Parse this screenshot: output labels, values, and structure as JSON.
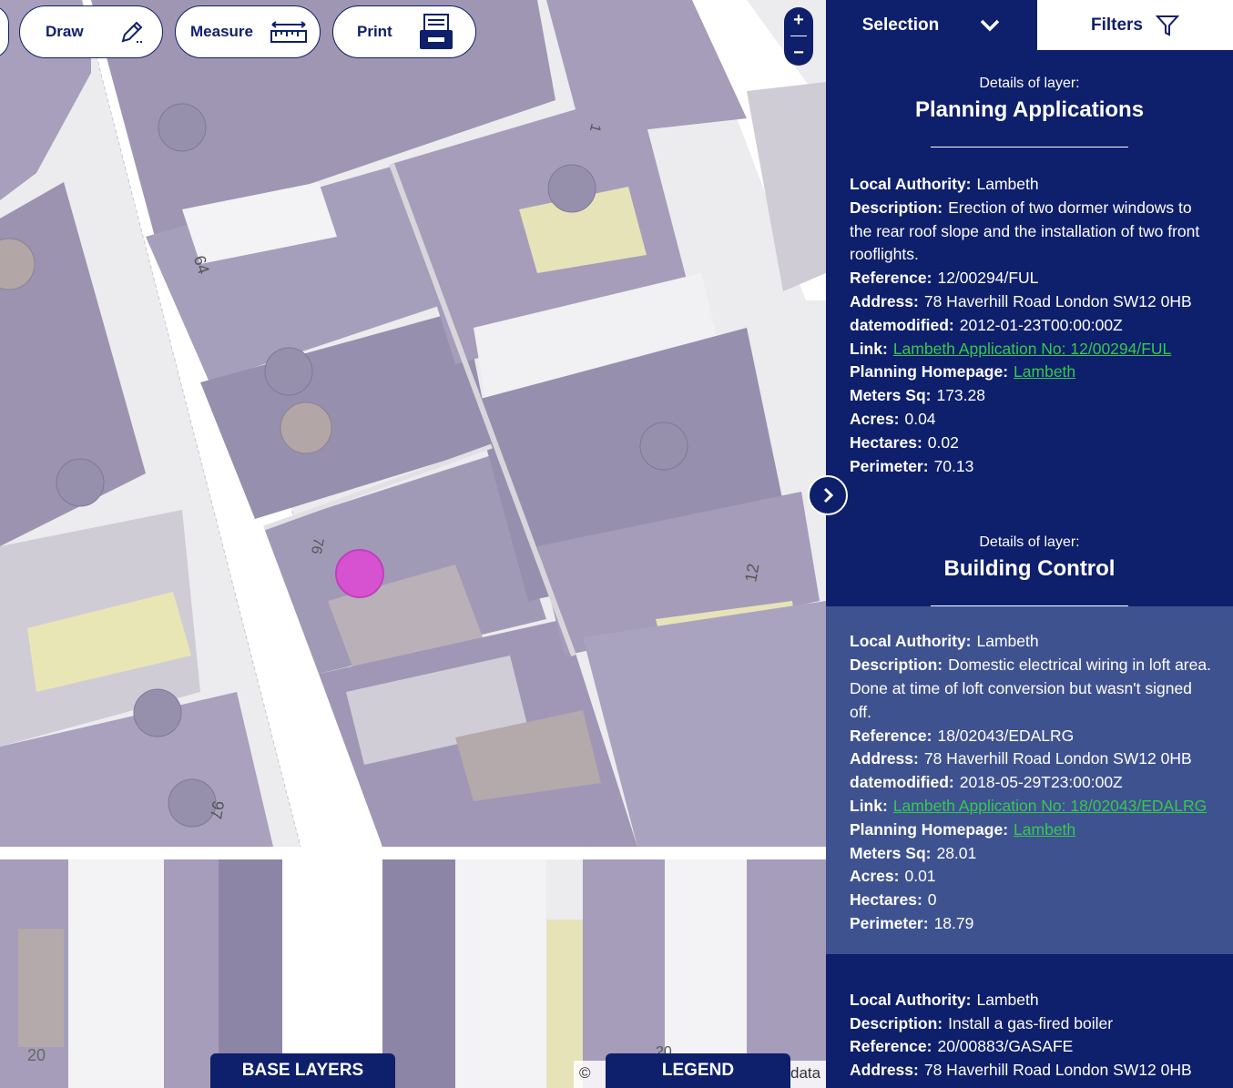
{
  "toolbar": {
    "draw_label": "Draw",
    "measure_label": "Measure",
    "print_label": "Print"
  },
  "zoom": {
    "in": "+",
    "out": "−"
  },
  "map": {
    "house_numbers": [
      "64",
      "76",
      "97",
      "12",
      "1",
      "20",
      "20"
    ],
    "attribution": "©",
    "attribution_tail": "data"
  },
  "bottom_tabs": {
    "base_layers": "BASE LAYERS",
    "legend": "LEGEND"
  },
  "panel": {
    "tabs": {
      "selection": "Selection",
      "filters": "Filters"
    },
    "layers": [
      {
        "sub": "Details of layer:",
        "name": "Planning Applications",
        "records": [
          {
            "la_label": "Local Authority:",
            "la": "Lambeth",
            "desc_label": "Description:",
            "desc": "Erection of two dormer windows to the rear roof slope and the installation of two front rooflights.",
            "ref_label": "Reference:",
            "ref": "12/00294/FUL",
            "addr_label": "Address:",
            "addr": "78 Haverhill Road London SW12 0HB",
            "dm_label": "datemodified:",
            "dm": "2012-01-23T00:00:00Z",
            "link_label": "Link:",
            "link": "Lambeth Application No: 12/00294/FUL",
            "home_label": "Planning Homepage:",
            "home": "Lambeth",
            "msq_label": "Meters Sq:",
            "msq": "173.28",
            "acres_label": "Acres:",
            "acres": "0.04",
            "ha_label": "Hectares:",
            "ha": "0.02",
            "per_label": "Perimeter:",
            "per": "70.13"
          }
        ]
      },
      {
        "sub": "Details of layer:",
        "name": "Building Control",
        "records": [
          {
            "la_label": "Local Authority:",
            "la": "Lambeth",
            "desc_label": "Description:",
            "desc": "Domestic electrical wiring in loft area. Done at time of loft conversion but wasn't signed off.",
            "ref_label": "Reference:",
            "ref": "18/02043/EDALRG",
            "addr_label": "Address:",
            "addr": "78 Haverhill Road London SW12 0HB",
            "dm_label": "datemodified:",
            "dm": "2018-05-29T23:00:00Z",
            "link_label": "Link:",
            "link": "Lambeth Application No: 18/02043/EDALRG",
            "home_label": "Planning Homepage:",
            "home": "Lambeth",
            "msq_label": "Meters Sq:",
            "msq": "28.01",
            "acres_label": "Acres:",
            "acres": "0.01",
            "ha_label": "Hectares:",
            "ha": "0",
            "per_label": "Perimeter:",
            "per": "18.79"
          },
          {
            "la_label": "Local Authority:",
            "la": "Lambeth",
            "desc_label": "Description:",
            "desc": "Install a gas-fired boiler",
            "ref_label": "Reference:",
            "ref": "20/00883/GASAFE",
            "addr_label": "Address:",
            "addr": "78 Haverhill Road London SW12 0HB"
          }
        ]
      }
    ]
  },
  "colors": {
    "navy": "#0e1f6b",
    "alt_row": "#3f5290",
    "link_green": "#35c94f",
    "marker": "#d94fd2"
  }
}
